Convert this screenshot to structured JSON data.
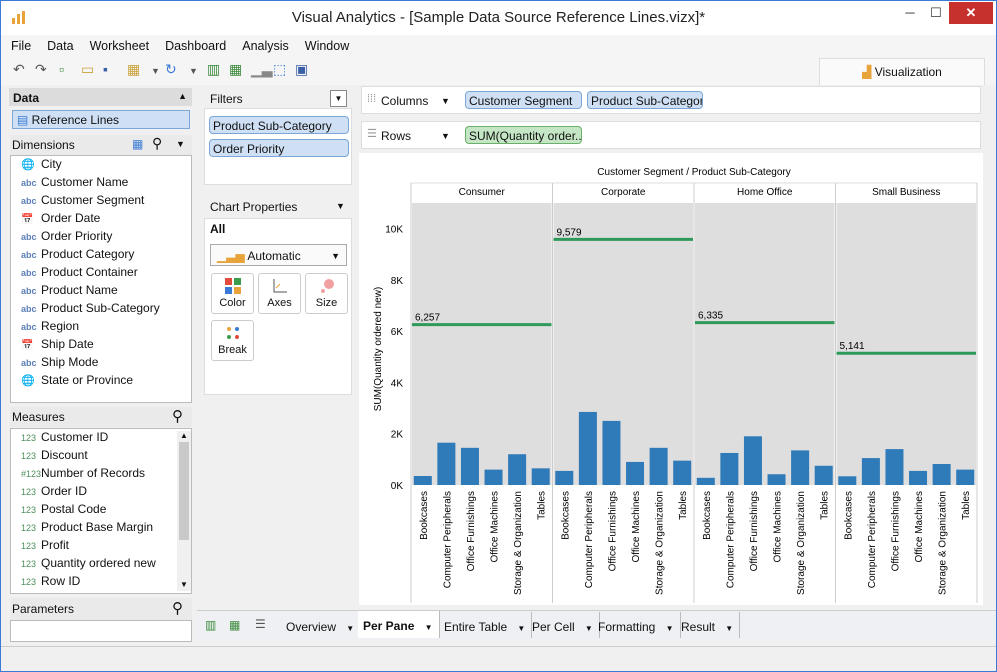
{
  "window": {
    "title": "Visual Analytics - [Sample Data Source Reference Lines.vizx]*",
    "min": "─",
    "max": "☐",
    "close": "✕"
  },
  "menu": [
    "File",
    "Data",
    "Worksheet",
    "Dashboard",
    "Analysis",
    "Window"
  ],
  "visualization_tab": "Visualization",
  "data_panel": {
    "header": "Data",
    "datasource": "Reference Lines",
    "dimensions_label": "Dimensions",
    "dimensions": [
      {
        "type": "geo",
        "name": "City"
      },
      {
        "type": "abc",
        "name": "Customer Name"
      },
      {
        "type": "abc",
        "name": "Customer Segment"
      },
      {
        "type": "date",
        "name": "Order Date"
      },
      {
        "type": "abc",
        "name": "Order Priority"
      },
      {
        "type": "abc",
        "name": "Product Category"
      },
      {
        "type": "abc",
        "name": "Product Container"
      },
      {
        "type": "abc",
        "name": "Product Name"
      },
      {
        "type": "abc",
        "name": "Product Sub-Category"
      },
      {
        "type": "abc",
        "name": "Region"
      },
      {
        "type": "date",
        "name": "Ship Date"
      },
      {
        "type": "abc",
        "name": "Ship Mode"
      },
      {
        "type": "geo",
        "name": "State or Province"
      }
    ],
    "measures_label": "Measures",
    "measures": [
      {
        "type": "123",
        "name": "Customer ID"
      },
      {
        "type": "123",
        "name": "Discount"
      },
      {
        "type": "#123",
        "name": "Number of Records"
      },
      {
        "type": "123",
        "name": "Order ID"
      },
      {
        "type": "123",
        "name": "Postal Code"
      },
      {
        "type": "123",
        "name": "Product Base Margin"
      },
      {
        "type": "123",
        "name": "Profit"
      },
      {
        "type": "123",
        "name": "Quantity ordered new"
      },
      {
        "type": "123",
        "name": "Row ID"
      }
    ],
    "parameters_label": "Parameters"
  },
  "filters": {
    "label": "Filters",
    "items": [
      "Product Sub-Category",
      "Order Priority"
    ]
  },
  "chart_properties": {
    "label": "Chart Properties",
    "all": "All",
    "mark_type": "Automatic",
    "cards": [
      "Color",
      "Axes",
      "Size",
      "Break"
    ]
  },
  "shelves": {
    "columns_label": "Columns",
    "columns": [
      "Customer Segment",
      "Product Sub-Category"
    ],
    "rows_label": "Rows",
    "rows": [
      "SUM(Quantity order..."
    ]
  },
  "sheets": [
    "Overview",
    "Per Pane",
    "Entire Table",
    "Per Cell",
    "Formatting",
    "Result"
  ],
  "active_sheet": "Per Pane",
  "colors": {
    "bar": "#2f7ab8",
    "refline": "#2e9a5a",
    "pane": "#dedede"
  },
  "chart_data": {
    "type": "bar",
    "title": "Customer Segment / Product Sub-Category",
    "ylabel": "SUM(Quantity ordered new)",
    "ylim": [
      0,
      11000
    ],
    "yticks": [
      {
        "v": 0,
        "label": "0K"
      },
      {
        "v": 2000,
        "label": "2K"
      },
      {
        "v": 4000,
        "label": "4K"
      },
      {
        "v": 6000,
        "label": "6K"
      },
      {
        "v": 8000,
        "label": "8K"
      },
      {
        "v": 10000,
        "label": "10K"
      }
    ],
    "categories": [
      "Bookcases",
      "Computer Peripherals",
      "Office Furnishings",
      "Office Machines",
      "Storage & Organization",
      "Tables"
    ],
    "panes": [
      {
        "name": "Consumer",
        "values": [
          350,
          1650,
          1450,
          600,
          1200,
          650
        ],
        "refline": 6257,
        "refline_label": "6,257"
      },
      {
        "name": "Corporate",
        "values": [
          550,
          2850,
          2500,
          900,
          1450,
          950
        ],
        "refline": 9579,
        "refline_label": "9,579"
      },
      {
        "name": "Home Office",
        "values": [
          280,
          1250,
          1900,
          420,
          1350,
          750
        ],
        "refline": 6335,
        "refline_label": "6,335"
      },
      {
        "name": "Small Business",
        "values": [
          340,
          1050,
          1400,
          550,
          820,
          600
        ],
        "refline": 5141,
        "refline_label": "5,141"
      }
    ]
  }
}
